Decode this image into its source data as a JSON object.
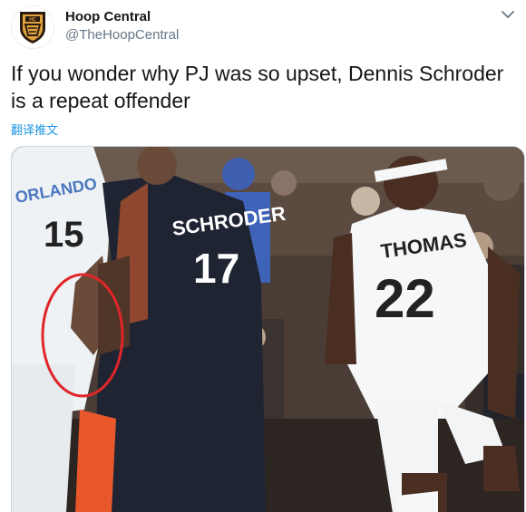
{
  "tweet": {
    "author": {
      "display_name": "Hoop Central",
      "handle": "@TheHoopCentral",
      "avatar_icon": "hoop-central-shield-logo"
    },
    "more_icon": "chevron-down-icon",
    "text": "If you wonder why PJ was so upset, Dennis Schroder is a repeat offender",
    "translate_label": "翻译推文",
    "media": {
      "type": "video-still",
      "players": [
        {
          "name": "SCHRODER",
          "number": "17",
          "jersey_color": "#1f2433"
        },
        {
          "name": "THOMAS",
          "number": "22",
          "jersey_color": "#ffffff"
        },
        {
          "name": "ORLANDO",
          "number": "15",
          "jersey_color": "#ffffff"
        }
      ],
      "highlight_color": "#e0262a"
    }
  }
}
